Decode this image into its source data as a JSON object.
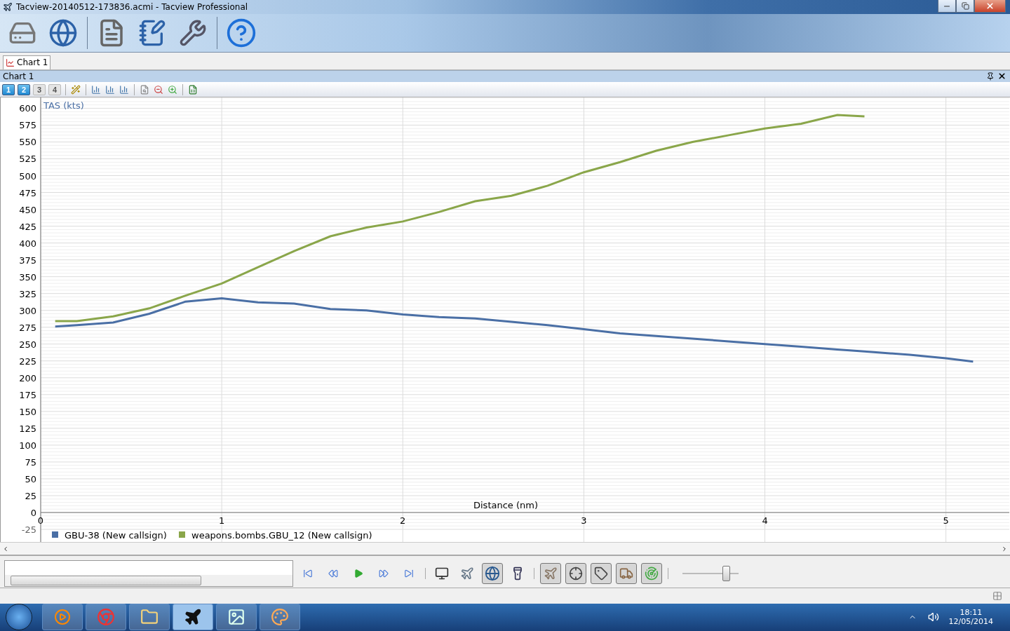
{
  "window": {
    "title": "Tacview-20140512-173836.acmi - Tacview Professional"
  },
  "document_tabs": [
    {
      "label": "Chart 1",
      "selected": true
    }
  ],
  "panel": {
    "title": "Chart 1"
  },
  "chart_pages": [
    {
      "label": "1",
      "selected": true
    },
    {
      "label": "2",
      "selected": true
    },
    {
      "label": "3",
      "selected": false
    },
    {
      "label": "4",
      "selected": false
    }
  ],
  "chart": {
    "chart_data": {
      "type": "line",
      "xlabel": "Distance (nm)",
      "ylabel": "TAS (kts)",
      "grid": true,
      "legend": true,
      "x": [
        0.08,
        0.2,
        0.4,
        0.6,
        0.8,
        1.0,
        1.2,
        1.4,
        1.6,
        1.8,
        2.0,
        2.2,
        2.4,
        2.6,
        2.8,
        3.0,
        3.2,
        3.4,
        3.6,
        3.8,
        4.0,
        4.2,
        4.4,
        4.55,
        4.8,
        5.0,
        5.15
      ],
      "series": [
        {
          "name": "GBU-38 (New callsign)",
          "color": "#4a6fa5",
          "values": [
            276,
            278,
            282,
            295,
            313,
            318,
            312,
            310,
            302,
            300,
            294,
            290,
            288,
            283,
            278,
            272,
            266,
            262,
            258,
            254,
            250,
            246,
            242,
            239,
            234,
            229,
            224
          ]
        },
        {
          "name": "weapons.bombs.GBU_12 (New callsign)",
          "color": "#8aa64a",
          "values": [
            284,
            284,
            291,
            303,
            322,
            340,
            364,
            388,
            410,
            423,
            432,
            446,
            462,
            470,
            485,
            505,
            520,
            537,
            550,
            560,
            570,
            577,
            590,
            588,
            null,
            null,
            null
          ]
        }
      ],
      "xlim": [
        0,
        5.35
      ],
      "ylim": [
        -25,
        615
      ],
      "xticks": [
        0,
        1,
        2,
        3,
        4,
        5
      ],
      "yticks": [
        -25,
        0,
        25,
        50,
        75,
        100,
        125,
        150,
        175,
        200,
        225,
        250,
        275,
        300,
        325,
        350,
        375,
        400,
        425,
        450,
        475,
        500,
        525,
        550,
        575,
        600
      ]
    }
  },
  "player": {
    "speed_slider": {
      "level": 0.78
    }
  },
  "taskbar": {
    "time": "18:11",
    "date": "12/05/2014"
  }
}
